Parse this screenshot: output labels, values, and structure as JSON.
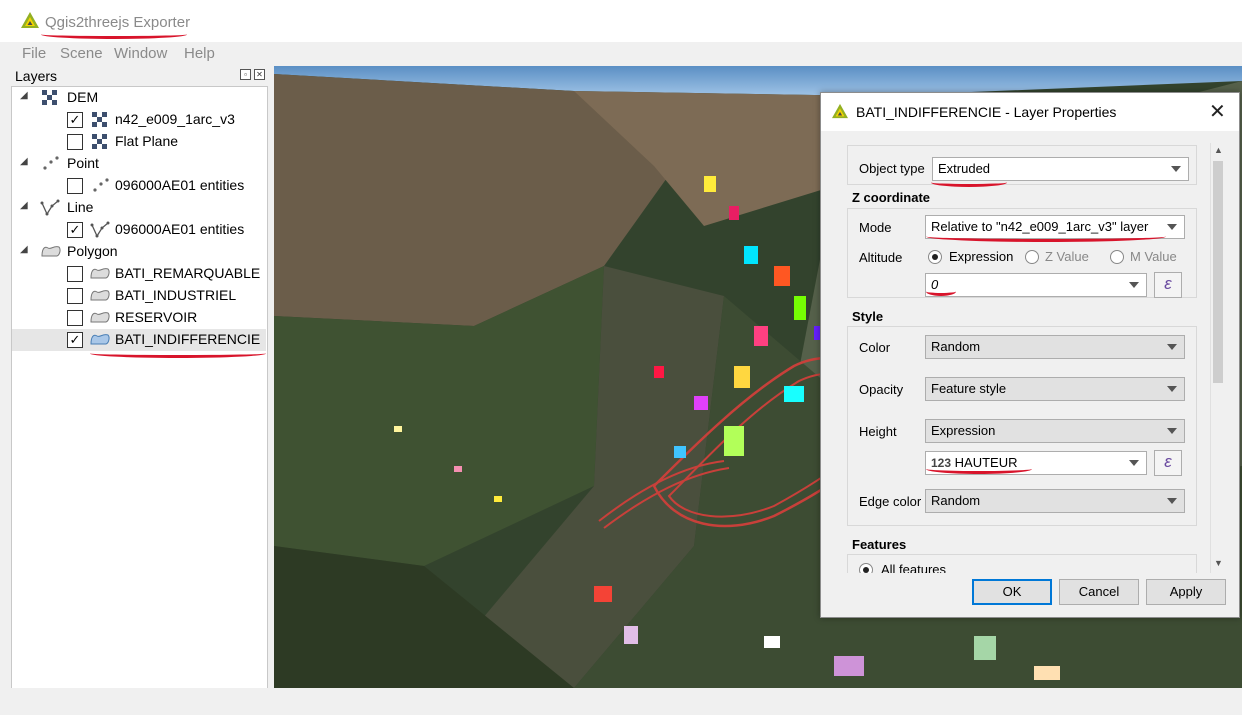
{
  "app": {
    "title": "Qgis2threejs Exporter"
  },
  "menu": {
    "file": "File",
    "scene": "Scene",
    "window": "Window",
    "help": "Help"
  },
  "layers_panel": {
    "title": "Layers",
    "groups": {
      "dem": "DEM",
      "point": "Point",
      "line": "Line",
      "polygon": "Polygon"
    },
    "items": {
      "dem_layer": {
        "label": "n42_e009_1arc_v3",
        "checked": true
      },
      "flat_plane": {
        "label": "Flat Plane",
        "checked": false
      },
      "point_layer": {
        "label": "096000AE01 entities",
        "checked": false
      },
      "line_layer": {
        "label": "096000AE01 entities",
        "checked": true
      },
      "bati_remarquable": {
        "label": "BATI_REMARQUABLE",
        "checked": false
      },
      "bati_industriel": {
        "label": "BATI_INDUSTRIEL",
        "checked": false
      },
      "reservoir": {
        "label": "RESERVOIR",
        "checked": false
      },
      "bati_indifferencie": {
        "label": "BATI_INDIFFERENCIE",
        "checked": true,
        "selected": true
      }
    },
    "check_mark": "✓"
  },
  "dialog": {
    "title": "BATI_INDIFFERENCIE - Layer Properties",
    "close": "✕",
    "object_type": {
      "label": "Object type",
      "value": "Extruded"
    },
    "z_coordinate": {
      "section": "Z coordinate",
      "mode_label": "Mode",
      "mode_value": "Relative to \"n42_e009_1arc_v3\" layer",
      "altitude_label": "Altitude",
      "altitude_options": [
        "Expression",
        "Z Value",
        "M Value"
      ],
      "altitude_selected": "Expression",
      "expression_value": "0"
    },
    "style": {
      "section": "Style",
      "color_label": "Color",
      "color_value": "Random",
      "opacity_label": "Opacity",
      "opacity_value": "Feature style",
      "height_label": "Height",
      "height_value": "Expression",
      "height_field_prefix": "123",
      "height_field": "HAUTEUR",
      "edge_color_label": "Edge color",
      "edge_color_value": "Random"
    },
    "features": {
      "section": "Features",
      "all_features": "All features"
    },
    "buttons": {
      "ok": "OK",
      "cancel": "Cancel",
      "apply": "Apply"
    },
    "expression_icon": "ε"
  },
  "colors": {
    "annotation_red": "#d8142b",
    "qgis_green": "#93b023",
    "dialog_default_blue": "#0078d7"
  }
}
